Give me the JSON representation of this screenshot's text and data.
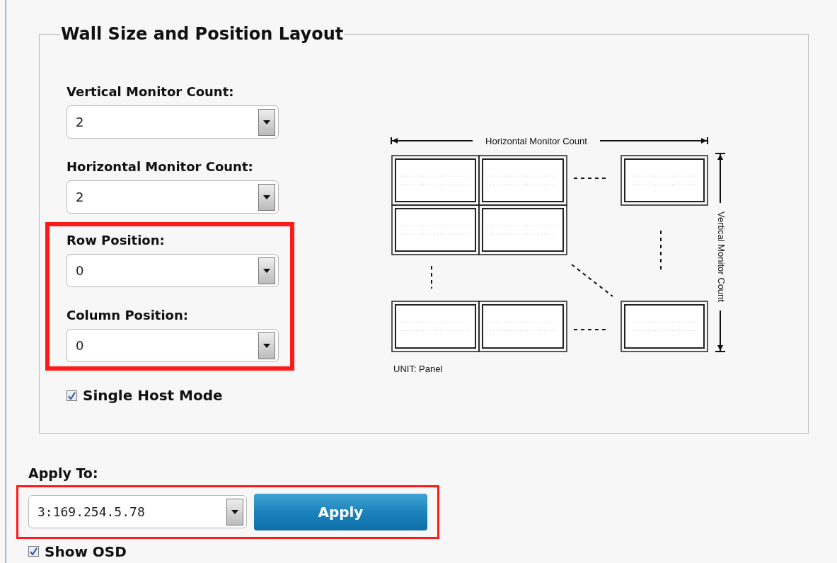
{
  "layout": {
    "legend": "Wall Size and Position Layout",
    "groups": [
      {
        "highlighted": false,
        "fields": [
          {
            "label": "Vertical Monitor Count:",
            "value": "2"
          },
          {
            "label": "Horizontal Monitor Count:",
            "value": "2"
          }
        ]
      },
      {
        "highlighted": true,
        "fields": [
          {
            "label": "Row Position:",
            "value": "0"
          },
          {
            "label": "Column Position:",
            "value": "0"
          }
        ]
      }
    ],
    "single_host_mode": {
      "label": "Single Host Mode",
      "checked": true
    },
    "diagram": {
      "horizontal_label": "Horizontal Monitor Count",
      "vertical_label": "Vertical Monitor Count",
      "unit": "UNIT: Panel"
    }
  },
  "apply": {
    "label": "Apply To:",
    "highlighted": true,
    "value": "3:169.254.5.78",
    "button": "Apply"
  },
  "show_osd": {
    "label": "Show OSD",
    "checked": true
  }
}
